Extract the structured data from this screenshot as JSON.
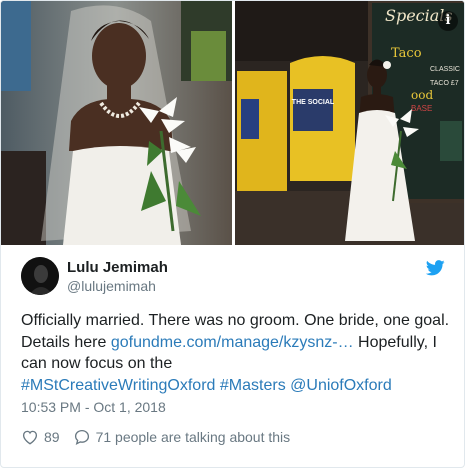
{
  "media": {
    "left_photo_alt": "Bride in a white wedding dress holding white lilies",
    "right_photo_alt": "Bride in a white dress standing in a bar holding lilies",
    "signs": {
      "specials": "Specials",
      "taco": "Taco",
      "board_lines": [
        "CLASSIC",
        "TACO £7",
        "ood",
        "BASE"
      ],
      "social": "THE SOCIAL"
    },
    "info_icon": "i"
  },
  "tweet": {
    "display_name": "Lulu Jemimah",
    "handle": "@lulujemimah",
    "text_before_link": "Officially married. There was no groom. One bride, one goal. Details here ",
    "link": "gofundme.com/manage/kzysnz-…",
    "text_after_link": " Hopefully, I can now focus on the ",
    "hashtag_1": "#MStCreativeWritingOxford",
    "hashtag_2": "#Masters",
    "mention": "@UniofOxford",
    "timestamp": "10:53 PM - Oct 1, 2018"
  },
  "actions": {
    "likes": "89",
    "talking": "71 people are talking about this"
  },
  "colors": {
    "link": "#2b7bb9",
    "twitter_blue": "#1da1f2",
    "muted": "#697882",
    "text": "#1c2022"
  },
  "icons": [
    "info-icon",
    "twitter-bird-icon",
    "heart-icon",
    "speech-bubble-icon"
  ]
}
